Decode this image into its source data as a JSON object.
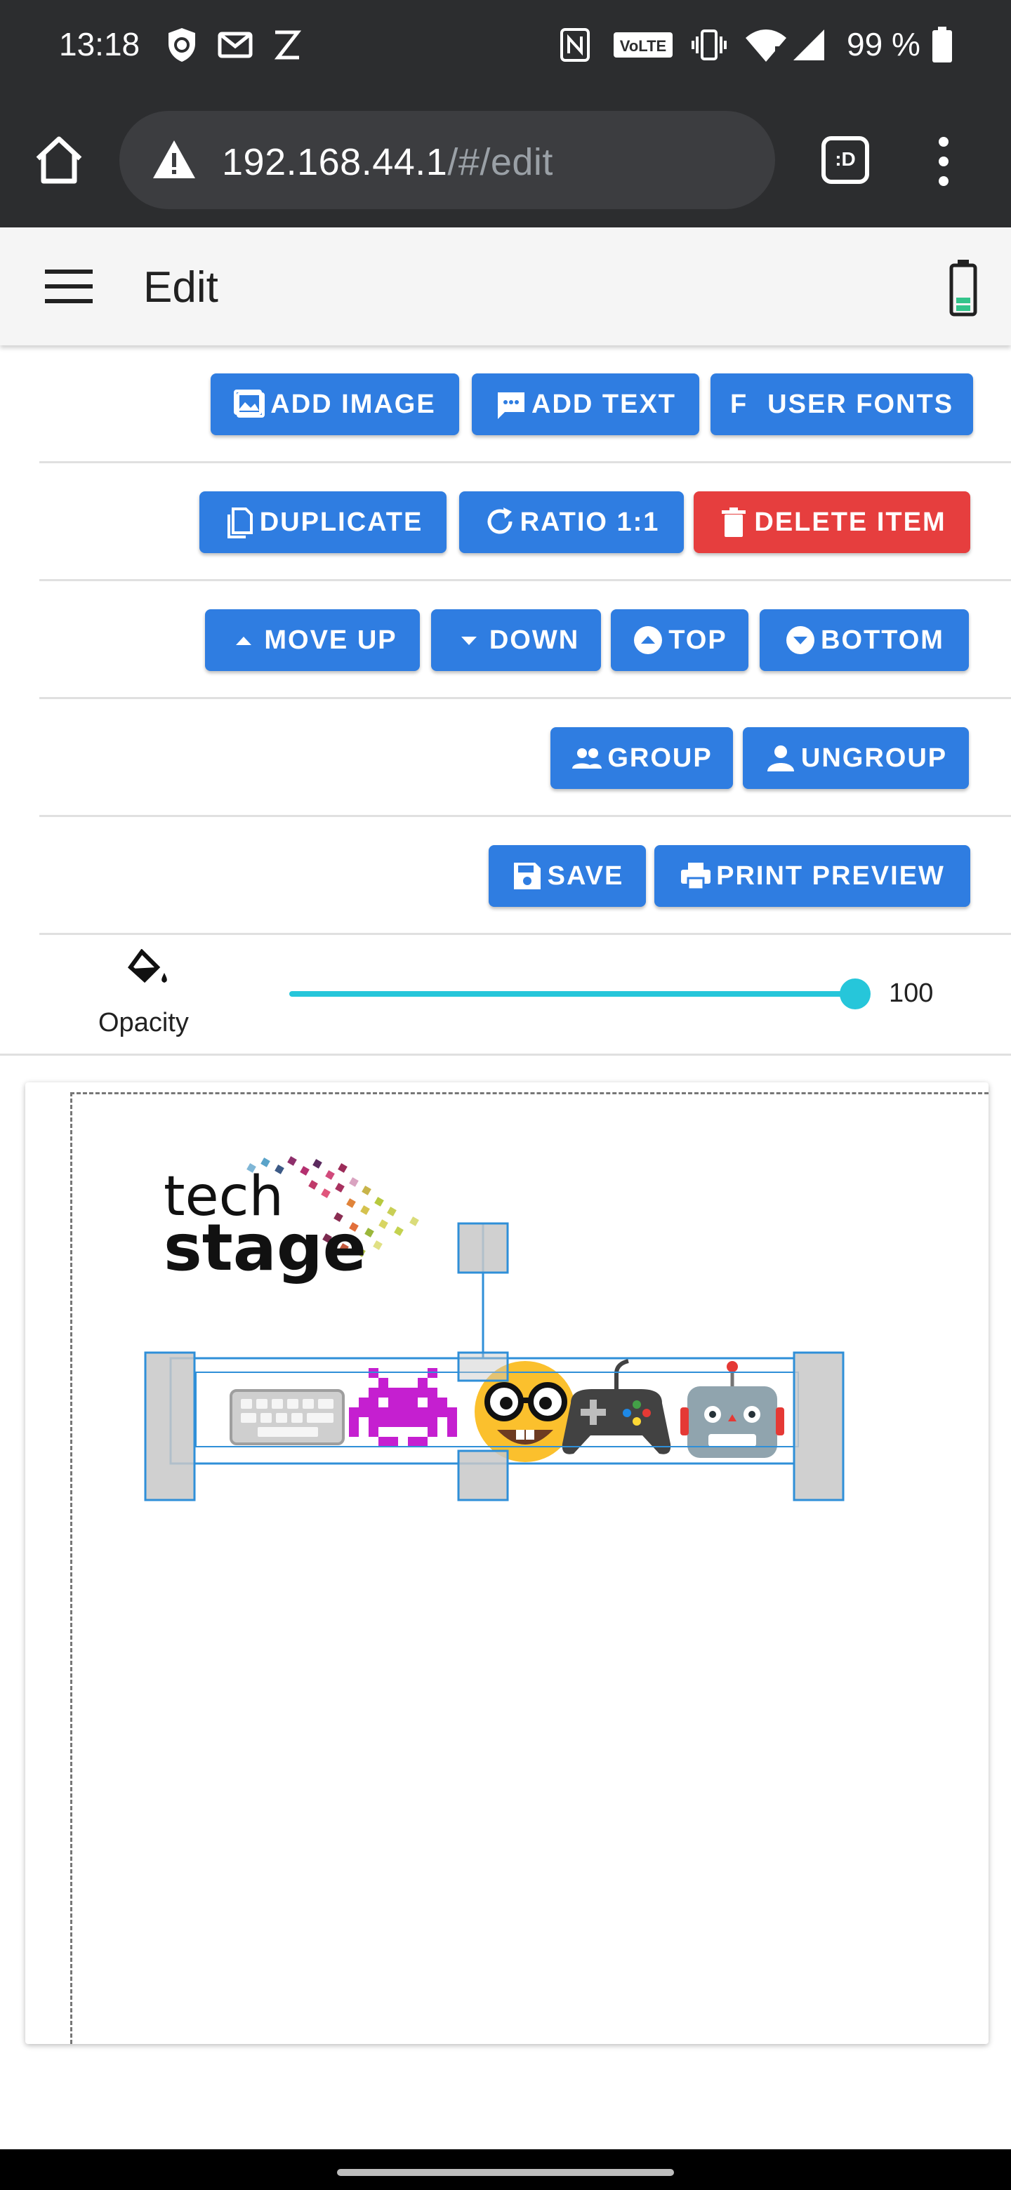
{
  "status_bar": {
    "time": "13:18",
    "battery_percent": "99 %",
    "left_icons": [
      "shield-icon",
      "gmail-icon",
      "z-app-icon"
    ],
    "right_icons": [
      "nfc-icon",
      "volte-icon",
      "vibrate-icon",
      "wifi-icon",
      "signal-icon",
      "battery-icon"
    ]
  },
  "browser": {
    "url_host": "192.168.44.1",
    "url_path": "/#/edit",
    "tab_switcher_label": ":D"
  },
  "app_bar": {
    "title": "Edit"
  },
  "toolbar": {
    "row1": {
      "add_image": "ADD IMAGE",
      "add_text": "ADD TEXT",
      "user_fonts": "USER FONTS",
      "user_fonts_glyph": "F"
    },
    "row2": {
      "duplicate": "DUPLICATE",
      "ratio": "RATIO 1:1",
      "delete_item": "DELETE ITEM"
    },
    "row3": {
      "move_up": "MOVE UP",
      "down": "DOWN",
      "top": "TOP",
      "bottom": "BOTTOM"
    },
    "row4": {
      "group": "GROUP",
      "ungroup": "UNGROUP"
    },
    "row5": {
      "save": "SAVE",
      "print_preview": "PRINT PREVIEW"
    }
  },
  "opacity": {
    "label": "Opacity",
    "value": "100",
    "fraction": 1.0
  },
  "canvas": {
    "logo_text_line1": "tech",
    "logo_text_line2": "stage",
    "emoji_items": [
      "keyboard-emoji",
      "alien-monster-emoji",
      "nerd-face-emoji",
      "game-controller-emoji",
      "robot-emoji"
    ]
  },
  "colors": {
    "primary_button": "#2f7de1",
    "danger_button": "#e63e3e",
    "slider": "#26c6da",
    "selection": "#2f8fd8"
  }
}
